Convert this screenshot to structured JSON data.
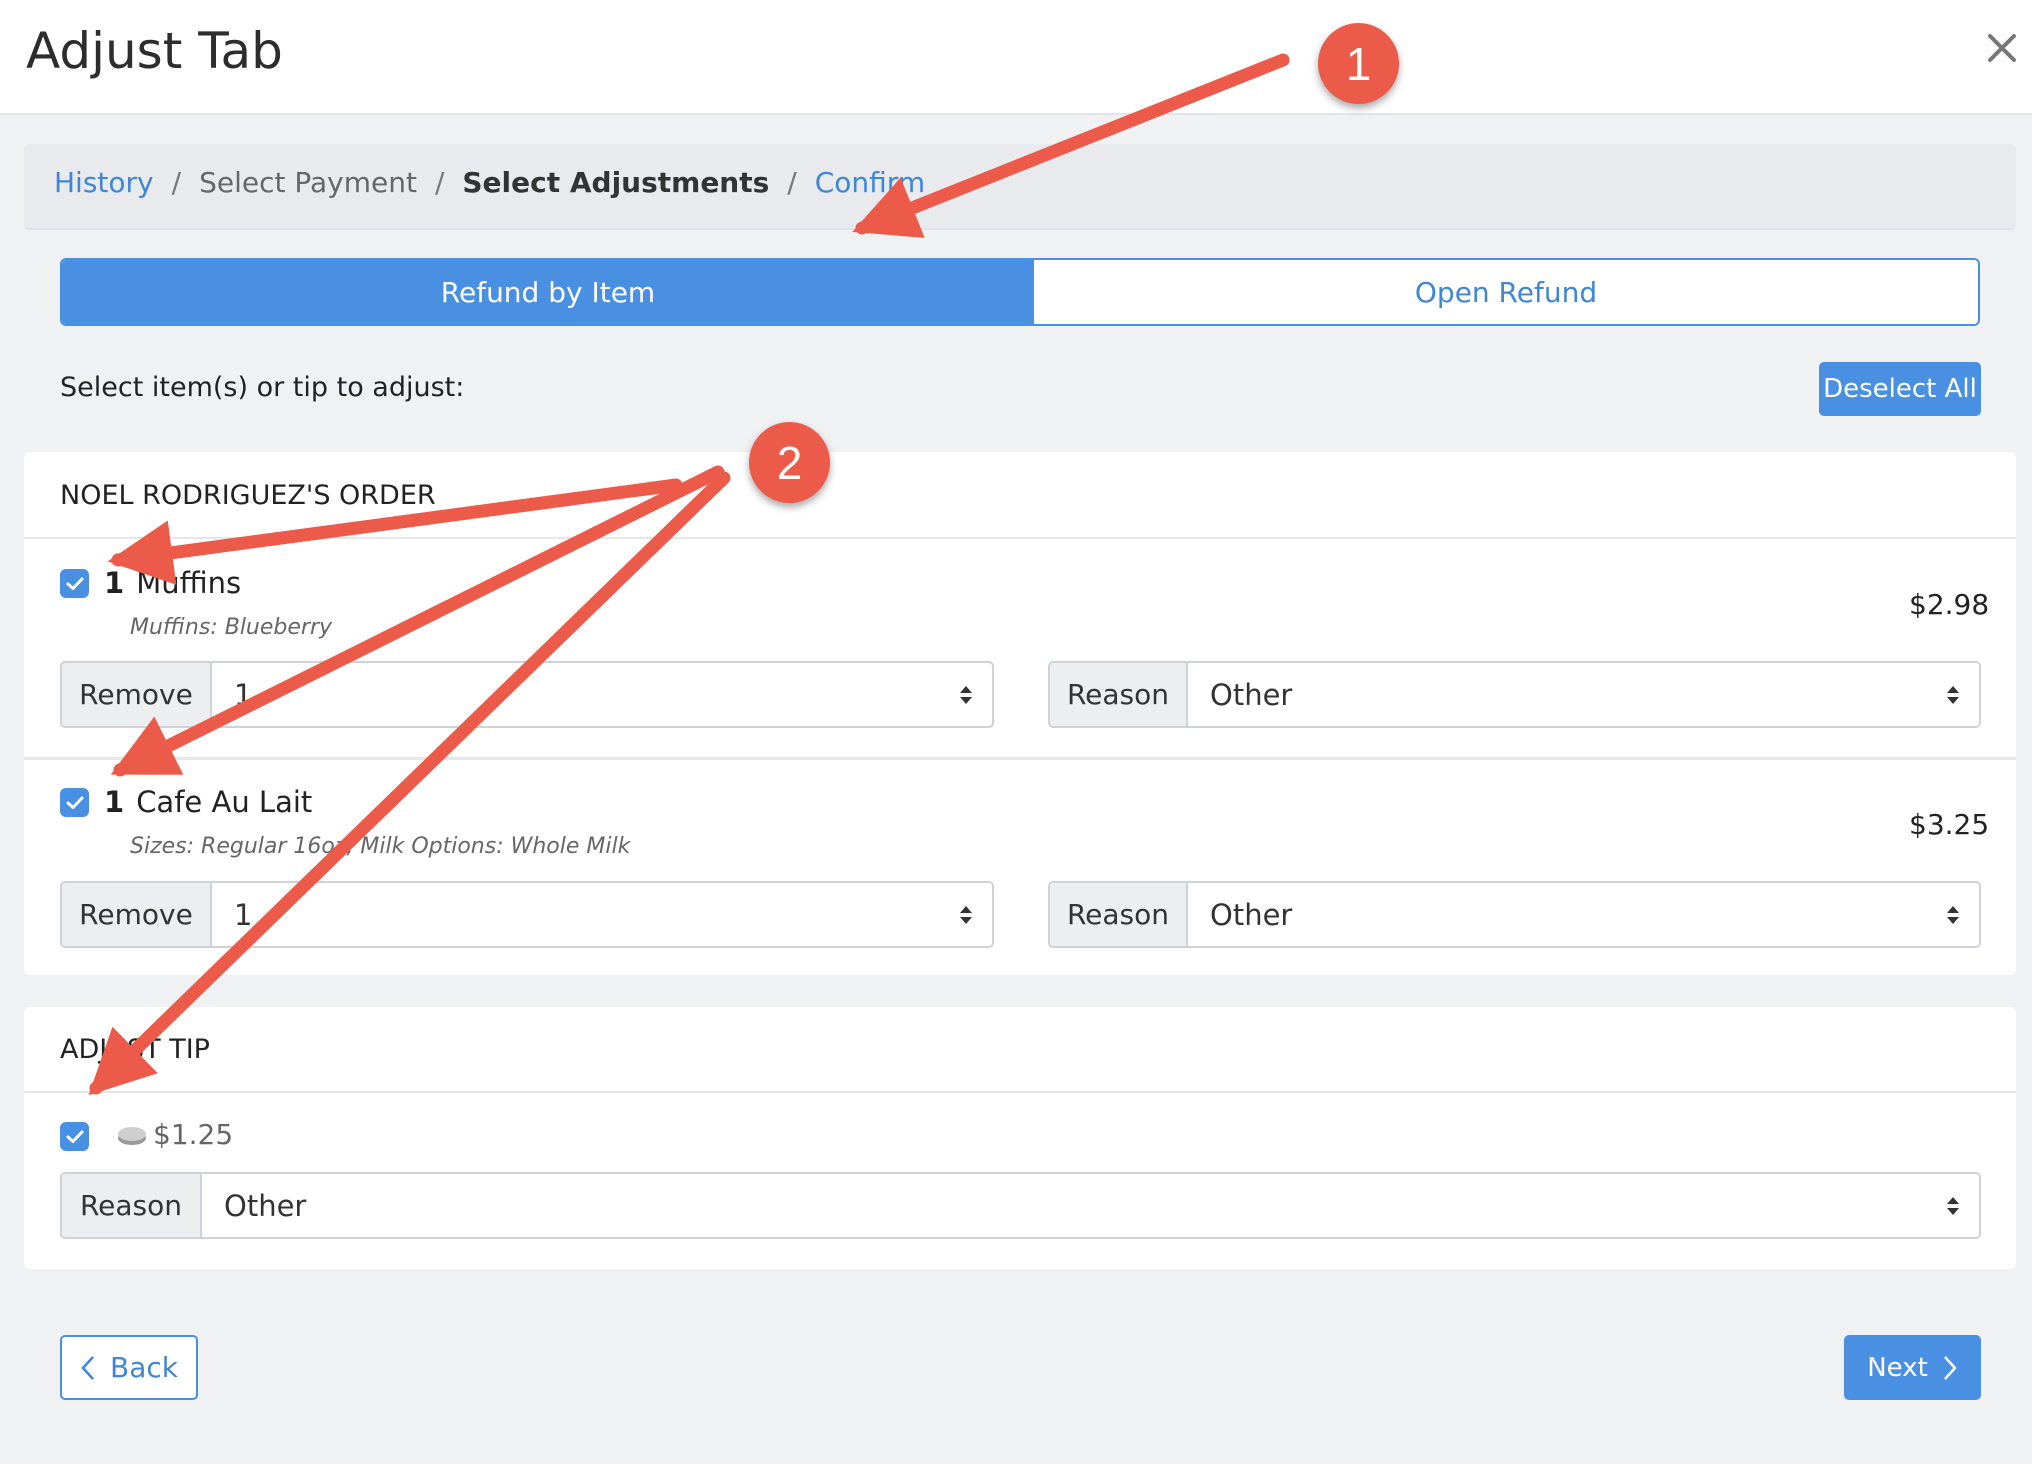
{
  "header": {
    "title": "Adjust Tab",
    "close_icon": "close-icon"
  },
  "breadcrumb": {
    "items": [
      {
        "label": "History",
        "state": "link"
      },
      {
        "label": "Select Payment",
        "state": "muted"
      },
      {
        "label": "Select Adjustments",
        "state": "active"
      },
      {
        "label": "Confirm",
        "state": "link"
      }
    ],
    "separator": "/"
  },
  "refund_mode": {
    "options": [
      "Refund by Item",
      "Open Refund"
    ],
    "selected": "Refund by Item"
  },
  "instruction": "Select item(s) or tip to adjust:",
  "deselect_label": "Deselect All",
  "order": {
    "title": "NOEL RODRIGUEZ'S ORDER",
    "items": [
      {
        "checked": true,
        "qty": "1",
        "name": "Muffins",
        "mods": "Muffins: Blueberry",
        "price": "$2.98",
        "remove_label": "Remove",
        "remove_value": "1",
        "reason_label": "Reason",
        "reason_value": "Other"
      },
      {
        "checked": true,
        "qty": "1",
        "name": "Cafe Au Lait",
        "mods": "Sizes: Regular 16oz, Milk Options: Whole Milk",
        "price": "$3.25",
        "remove_label": "Remove",
        "remove_value": "1",
        "reason_label": "Reason",
        "reason_value": "Other"
      }
    ]
  },
  "tip": {
    "title": "ADJUST TIP",
    "checked": true,
    "amount": "$1.25",
    "reason_label": "Reason",
    "reason_value": "Other",
    "icon": "coin-icon"
  },
  "footer": {
    "back_label": "Back",
    "next_label": "Next"
  },
  "annotations": {
    "badges": [
      "1",
      "2"
    ],
    "color": "#ec5a4a"
  },
  "colors": {
    "accent": "#4a90e2",
    "annotation": "#ec5a4a"
  }
}
